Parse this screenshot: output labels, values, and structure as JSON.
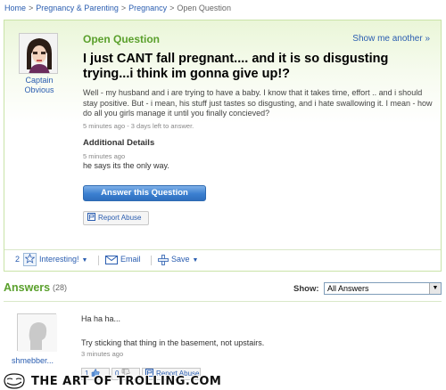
{
  "breadcrumb": {
    "items": [
      "Home",
      "Pregnancy & Parenting",
      "Pregnancy",
      "Open Question"
    ],
    "separator": ">"
  },
  "question": {
    "status_label": "Open Question",
    "show_more": "Show me another »",
    "asker": {
      "name_line1": "Captain",
      "name_line2": "Obvious",
      "avatar_icon": "avatar-icon"
    },
    "title": "I just CANT fall pregnant.... and it is so disgusting trying...i think im gonna give up!?",
    "body": "Well - my husband and i are trying to have a baby. I know that it takes time, effort .. and i should stay positive. But - i mean, his stuff just tastes so disgusting, and i hate swallowing it. I mean - how do all you girls manage it until you finally concieved?",
    "time": "5 minutes ago - 3 days left to answer.",
    "additional_details_heading": "Additional Details",
    "additional_time": "5 minutes ago",
    "additional_text": "he says its the only way.",
    "answer_button": "Answer this Question",
    "report_abuse": "Report Abuse"
  },
  "actions": {
    "interesting_count": "2",
    "interesting_label": "Interesting!",
    "email_label": "Email",
    "save_label": "Save"
  },
  "answers": {
    "heading": "Answers",
    "count": "(28)",
    "show_label": "Show:",
    "filter_selected": "All Answers",
    "items": [
      {
        "user": "shmebber...",
        "line1": "Ha ha ha...",
        "line2": "Try sticking that thing in the basement, not upstairs.",
        "time": "3 minutes ago",
        "thumbs_up": "1",
        "thumbs_down": "0",
        "report": "Report Abuse"
      }
    ]
  },
  "watermark": {
    "text": "THE ART OF TROLLING.COM"
  },
  "colors": {
    "accent_green": "#5aa02c",
    "link_blue": "#2a5db0",
    "button_blue": "#3b7fd0"
  }
}
